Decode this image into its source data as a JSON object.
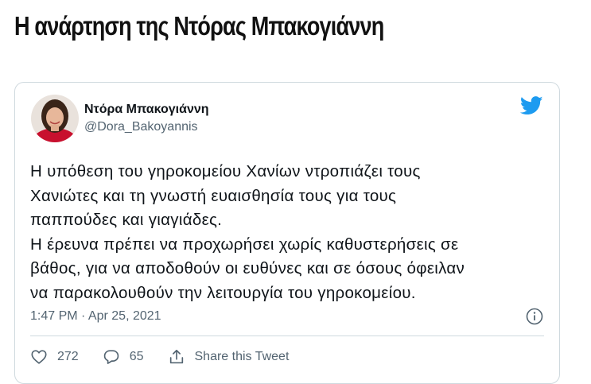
{
  "headline": "Η ανάρτηση της Ντόρας Μπακογιάννη",
  "tweet": {
    "author_name": "Ντόρα Μπακογιάννη",
    "author_handle": "@Dora_Bakoyannis",
    "text_lines": [
      "Η υπόθεση του γηροκομείου Χανίων ντροπιάζει τους",
      "Χανιώτες και τη γνωστή ευαισθησία τους για τους",
      "παππούδες και γιαγιάδες.",
      "Η έρευνα πρέπει να προχωρήσει χωρίς καθυστερήσεις σε",
      "βάθος, για να αποδοθούν οι ευθύνες και σε όσους όφειλαν",
      "να παρακολουθούν την λειτουργία του γηροκομείου."
    ],
    "timestamp": "1:47 PM · Apr 25, 2021",
    "likes": "272",
    "replies": "65",
    "share_label": "Share this Tweet"
  },
  "icons": {
    "bird": "twitter-bird-icon",
    "info": "info-icon",
    "like": "heart-icon",
    "reply": "reply-bubble-icon",
    "share": "share-icon"
  },
  "colors": {
    "twitter_blue": "#1d9bf0",
    "secondary_text": "#536471",
    "border": "#cfd9de"
  }
}
